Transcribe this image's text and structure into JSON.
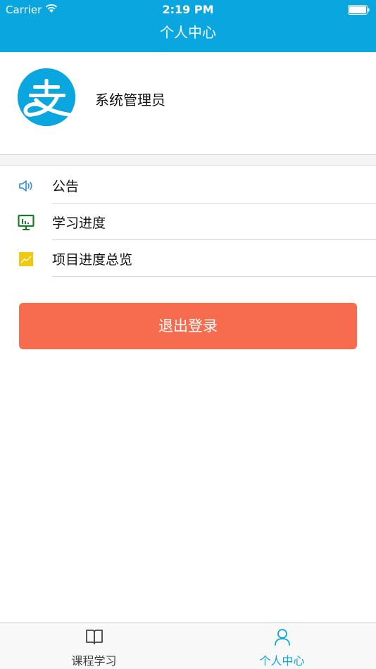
{
  "status_bar": {
    "carrier": "Carrier",
    "time": "2:19 PM"
  },
  "nav": {
    "title": "个人中心"
  },
  "profile": {
    "name": "系统管理员",
    "avatar_icon": "alipay-logo-icon"
  },
  "menu": {
    "items": [
      {
        "label": "公告",
        "icon": "speaker-icon",
        "icon_color": "#2d8ce0"
      },
      {
        "label": "学习进度",
        "icon": "presentation-board-icon",
        "icon_color": "#1d7a2b"
      },
      {
        "label": "项目进度总览",
        "icon": "line-chart-icon",
        "icon_color": "#f2c811"
      }
    ]
  },
  "logout": {
    "label": "退出登录",
    "color": "#f76c4e"
  },
  "tabbar": {
    "tabs": [
      {
        "label": "课程学习",
        "icon": "book-icon",
        "active": false
      },
      {
        "label": "个人中心",
        "icon": "person-icon",
        "active": true
      }
    ]
  },
  "colors": {
    "accent": "#0aa6e0"
  }
}
